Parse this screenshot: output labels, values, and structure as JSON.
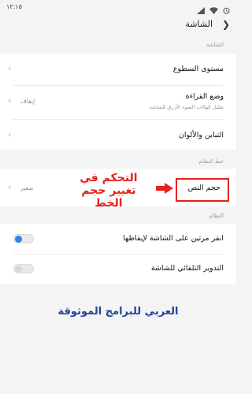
{
  "status_bar": {
    "time": "١٢:١٥"
  },
  "header": {
    "title": "الشاشة"
  },
  "sections": [
    {
      "label": "الشاشة",
      "rows": [
        {
          "label": "مستوى السطوع"
        },
        {
          "label": "وضع القراءة",
          "sub": "تقليل الهالات الضوء الأزرق للشاشة",
          "value": "إيقاف"
        },
        {
          "label": "التباين والألوان"
        }
      ]
    },
    {
      "label": "خط النظام",
      "rows": [
        {
          "label": "حجم النص",
          "value": "صغير"
        }
      ]
    },
    {
      "label": "النظام",
      "rows": [
        {
          "label": "انقر مرتين على الشاشة لإيقاظها",
          "toggle": "on"
        },
        {
          "label": "التدوير التلقائي للشاشة",
          "toggle": "off"
        }
      ]
    }
  ],
  "annotation": {
    "line1": "التحكم في",
    "line2": "تغيير حجم الخط"
  },
  "footer": {
    "brand": "العربي للبرامج الموثوقة"
  },
  "colors": {
    "annotation": "#e8211a",
    "brand": "#24439a",
    "toggle_on": "#2a86e8"
  }
}
